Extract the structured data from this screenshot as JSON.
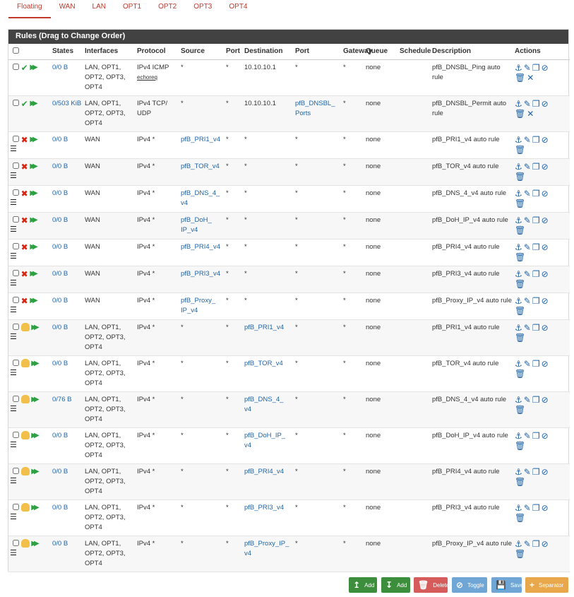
{
  "tabs": [
    "Floating",
    "WAN",
    "LAN",
    "OPT1",
    "OPT2",
    "OPT3",
    "OPT4"
  ],
  "panel_title": "Rules (Drag to Change Order)",
  "columns": [
    "States",
    "Interfaces",
    "Protocol",
    "Source",
    "Port",
    "Destination",
    "Port",
    "Gateway",
    "Queue",
    "Schedule",
    "Description",
    "Actions"
  ],
  "rows": [
    {
      "status": "pass",
      "states": "0/0 B",
      "interfaces": "LAN, OPT1, OPT2, OPT3, OPT4",
      "protocol": "IPv4 ICMP",
      "proto_sub": "echoreq",
      "source": "*",
      "sport": "*",
      "dest": "10.10.10.1",
      "dport": "*",
      "gateway": "*",
      "queue": "none",
      "schedule": "",
      "desc": "pfB_DNSBL_Ping auto rule"
    },
    {
      "status": "pass",
      "states": "0/503 KiB",
      "interfaces": "LAN, OPT1, OPT2, OPT3, OPT4",
      "protocol": "IPv4 TCP/ UDP",
      "proto_sub": "",
      "source": "*",
      "sport": "*",
      "dest": "10.10.10.1",
      "dport": "pfB_DNSBL_ Ports",
      "gateway": "*",
      "queue": "none",
      "schedule": "",
      "desc": "pfB_DNSBL_Permit auto rule"
    },
    {
      "status": "block",
      "states": "0/0 B",
      "interfaces": "WAN",
      "protocol": "IPv4 *",
      "proto_sub": "",
      "source": "pfB_PRI1_v4",
      "sport": "*",
      "dest": "*",
      "dport": "*",
      "gateway": "*",
      "queue": "none",
      "schedule": "",
      "desc": "pfB_PRI1_v4 auto rule"
    },
    {
      "status": "block",
      "states": "0/0 B",
      "interfaces": "WAN",
      "protocol": "IPv4 *",
      "proto_sub": "",
      "source": "pfB_TOR_v4",
      "sport": "*",
      "dest": "*",
      "dport": "*",
      "gateway": "*",
      "queue": "none",
      "schedule": "",
      "desc": "pfB_TOR_v4 auto rule"
    },
    {
      "status": "block",
      "states": "0/0 B",
      "interfaces": "WAN",
      "protocol": "IPv4 *",
      "proto_sub": "",
      "source": "pfB_DNS_4_ v4",
      "sport": "*",
      "dest": "*",
      "dport": "*",
      "gateway": "*",
      "queue": "none",
      "schedule": "",
      "desc": "pfB_DNS_4_v4 auto rule"
    },
    {
      "status": "block",
      "states": "0/0 B",
      "interfaces": "WAN",
      "protocol": "IPv4 *",
      "proto_sub": "",
      "source": "pfB_DoH_ IP_v4",
      "sport": "*",
      "dest": "*",
      "dport": "*",
      "gateway": "*",
      "queue": "none",
      "schedule": "",
      "desc": "pfB_DoH_IP_v4 auto rule"
    },
    {
      "status": "block",
      "states": "0/0 B",
      "interfaces": "WAN",
      "protocol": "IPv4 *",
      "proto_sub": "",
      "source": "pfB_PRI4_v4",
      "sport": "*",
      "dest": "*",
      "dport": "*",
      "gateway": "*",
      "queue": "none",
      "schedule": "",
      "desc": "pfB_PRI4_v4 auto rule"
    },
    {
      "status": "block",
      "states": "0/0 B",
      "interfaces": "WAN",
      "protocol": "IPv4 *",
      "proto_sub": "",
      "source": "pfB_PRI3_v4",
      "sport": "*",
      "dest": "*",
      "dport": "*",
      "gateway": "*",
      "queue": "none",
      "schedule": "",
      "desc": "pfB_PRI3_v4 auto rule"
    },
    {
      "status": "block",
      "states": "0/0 B",
      "interfaces": "WAN",
      "protocol": "IPv4 *",
      "proto_sub": "",
      "source": "pfB_Proxy_ IP_v4",
      "sport": "*",
      "dest": "*",
      "dport": "*",
      "gateway": "*",
      "queue": "none",
      "schedule": "",
      "desc": "pfB_Proxy_IP_v4 auto rule"
    },
    {
      "status": "match",
      "states": "0/0 B",
      "interfaces": "LAN, OPT1, OPT2, OPT3, OPT4",
      "protocol": "IPv4 *",
      "proto_sub": "",
      "source": "*",
      "sport": "*",
      "dest": "pfB_PRI1_v4",
      "dport": "*",
      "gateway": "*",
      "queue": "none",
      "schedule": "",
      "desc": "pfB_PRI1_v4 auto rule"
    },
    {
      "status": "match",
      "states": "0/0 B",
      "interfaces": "LAN, OPT1, OPT2, OPT3, OPT4",
      "protocol": "IPv4 *",
      "proto_sub": "",
      "source": "*",
      "sport": "*",
      "dest": "pfB_TOR_v4",
      "dport": "*",
      "gateway": "*",
      "queue": "none",
      "schedule": "",
      "desc": "pfB_TOR_v4 auto rule"
    },
    {
      "status": "match",
      "states": "0/76 B",
      "interfaces": "LAN, OPT1, OPT2, OPT3, OPT4",
      "protocol": "IPv4 *",
      "proto_sub": "",
      "source": "*",
      "sport": "*",
      "dest": "pfB_DNS_4_ v4",
      "dport": "*",
      "gateway": "*",
      "queue": "none",
      "schedule": "",
      "desc": "pfB_DNS_4_v4 auto rule"
    },
    {
      "status": "match",
      "states": "0/0 B",
      "interfaces": "LAN, OPT1, OPT2, OPT3, OPT4",
      "protocol": "IPv4 *",
      "proto_sub": "",
      "source": "*",
      "sport": "*",
      "dest": "pfB_DoH_IP_ v4",
      "dport": "*",
      "gateway": "*",
      "queue": "none",
      "schedule": "",
      "desc": "pfB_DoH_IP_v4 auto rule"
    },
    {
      "status": "match",
      "states": "0/0 B",
      "interfaces": "LAN, OPT1, OPT2, OPT3, OPT4",
      "protocol": "IPv4 *",
      "proto_sub": "",
      "source": "*",
      "sport": "*",
      "dest": "pfB_PRI4_v4",
      "dport": "*",
      "gateway": "*",
      "queue": "none",
      "schedule": "",
      "desc": "pfB_PRI4_v4 auto rule"
    },
    {
      "status": "match",
      "states": "0/0 B",
      "interfaces": "LAN, OPT1, OPT2, OPT3, OPT4",
      "protocol": "IPv4 *",
      "proto_sub": "",
      "source": "*",
      "sport": "*",
      "dest": "pfB_PRI3_v4",
      "dport": "*",
      "gateway": "*",
      "queue": "none",
      "schedule": "",
      "desc": "pfB_PRI3_v4 auto rule"
    },
    {
      "status": "match",
      "states": "0/0 B",
      "interfaces": "LAN, OPT1, OPT2, OPT3, OPT4",
      "protocol": "IPv4 *",
      "proto_sub": "",
      "source": "*",
      "sport": "*",
      "dest": "pfB_Proxy_IP_ v4",
      "dport": "*",
      "gateway": "*",
      "queue": "none",
      "schedule": "",
      "desc": "pfB_Proxy_IP_v4 auto rule"
    }
  ],
  "buttons": [
    {
      "label": "Add",
      "icon": "arrow-up-icon",
      "color": "#3c8d3c"
    },
    {
      "label": "Add",
      "icon": "arrow-down-icon",
      "color": "#3c8d3c"
    },
    {
      "label": "Delete",
      "icon": "trash-icon",
      "color": "#d65c5c"
    },
    {
      "label": "Toggle",
      "icon": "ban-icon",
      "color": "#6fa6d6"
    },
    {
      "label": "Save",
      "icon": "save-icon",
      "color": "#6fa6d6"
    },
    {
      "label": "Separator",
      "icon": "plus-icon",
      "color": "#e8a74a"
    }
  ]
}
